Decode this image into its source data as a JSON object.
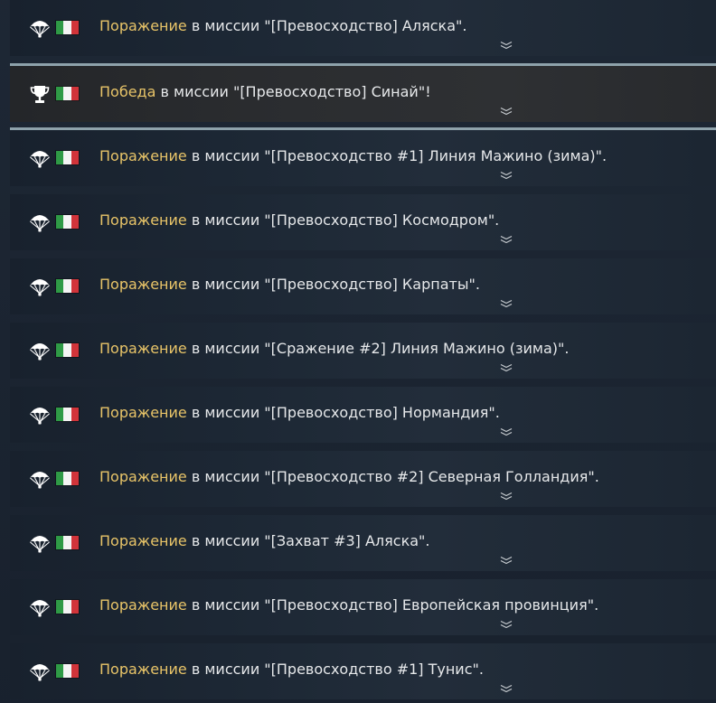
{
  "colors": {
    "result_text": "#e8c468",
    "body_text": "#e6e8ea",
    "divider": "#8ea2ab",
    "flag_green": "#2f9a46",
    "flag_white": "#f4f4f4",
    "flag_red": "#d1343a"
  },
  "rows": [
    {
      "result": "Поражение",
      "icon": "parachute-icon",
      "middle": " в миссии ",
      "mission": "\"[Превосходство] Аляска\"",
      "ending": "."
    },
    {
      "result": "Победа",
      "icon": "trophy-icon",
      "middle": " в миссии ",
      "mission": "\"[Превосходство] Синай\"",
      "ending": "!"
    },
    {
      "result": "Поражение",
      "icon": "parachute-icon",
      "middle": " в миссии ",
      "mission": "\"[Превосходство #1] Линия Мажино (зима)\"",
      "ending": "."
    },
    {
      "result": "Поражение",
      "icon": "parachute-icon",
      "middle": " в миссии ",
      "mission": "\"[Превосходство] Космодром\"",
      "ending": "."
    },
    {
      "result": "Поражение",
      "icon": "parachute-icon",
      "middle": " в миссии ",
      "mission": "\"[Превосходство] Карпаты\"",
      "ending": "."
    },
    {
      "result": "Поражение",
      "icon": "parachute-icon",
      "middle": " в миссии ",
      "mission": "\"[Сражение #2] Линия Мажино (зима)\"",
      "ending": "."
    },
    {
      "result": "Поражение",
      "icon": "parachute-icon",
      "middle": " в миссии ",
      "mission": "\"[Превосходство] Нормандия\"",
      "ending": "."
    },
    {
      "result": "Поражение",
      "icon": "parachute-icon",
      "middle": " в миссии ",
      "mission": "\"[Превосходство #2] Северная Голландия\"",
      "ending": "."
    },
    {
      "result": "Поражение",
      "icon": "parachute-icon",
      "middle": " в миссии ",
      "mission": "\"[Захват #3] Аляска\"",
      "ending": "."
    },
    {
      "result": "Поражение",
      "icon": "parachute-icon",
      "middle": " в миссии ",
      "mission": "\"[Превосходство] Европейская провинция\"",
      "ending": "."
    },
    {
      "result": "Поражение",
      "icon": "parachute-icon",
      "middle": " в миссии ",
      "mission": "\"[Превосходство #1] Тунис\"",
      "ending": "."
    }
  ]
}
